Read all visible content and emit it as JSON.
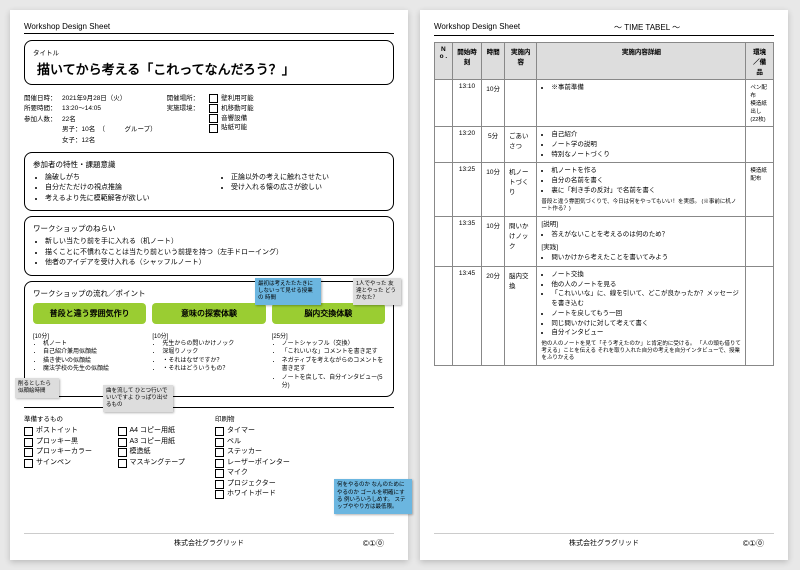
{
  "sheet_label": "Workshop Design Sheet",
  "timetable_label": "〜 TIME TABEL 〜",
  "title_label": "タイトル",
  "title": "描いてから考える「これってなんだろう？」",
  "meta": {
    "date_lbl": "開催日時：",
    "date": "2021年9月28日（火）",
    "time_lbl": "所要時間：",
    "time": "13:20〜14:05",
    "count_lbl": "参加人数：",
    "count": "22名",
    "count2": "男子：10名　（　　　グループ）",
    "count3": "女子：12名",
    "venue_lbl": "開催場所：",
    "env_lbl": "実施環境："
  },
  "env_opts": [
    "壁利用可能",
    "机移動可能",
    "音響設備",
    "貼紙可能"
  ],
  "sec1_h": "参加者の特性・課題意識",
  "sec1_a": [
    "論破しがち",
    "自分だただけの視点推論",
    "考えるより先に模範解答が欲しい"
  ],
  "sec1_b": [
    "正論以外の考えに触れさせたい",
    "受け入れる懐の広さが欲しい"
  ],
  "sec2_h": "ワークショップのねらい",
  "sec2": [
    "新しい当たり前を手に入れる（机ノート）",
    "描くことに不慣れなことは当たり前という前提を持つ（左手ドローイング）",
    "他者のアイデアを受け入れる（シャッフルノート）"
  ],
  "sec3_h": "ワークショップの流れ／ポイント",
  "flow": [
    {
      "t": "普段と違う雰囲気作り",
      "time": "[10分]",
      "d": [
        "机ノート",
        "自己紹介兼用似顔絵",
        "描き使いの似顔絵",
        "魔法学校の先生の似顔絵"
      ]
    },
    {
      "t": "意味の探索体験",
      "time": "[10分]",
      "d": [
        "先生からの問いかけノック",
        "深堀りノック",
        "・それはなぜですか？",
        "・それはどういうもの？"
      ]
    },
    {
      "t": "脳内交換体験",
      "time": "[25分]",
      "d": [
        "ノートシャッフル（交換）",
        "「これいいな」コメントを書き足す",
        "ネガティブを考えながらのコメントを書き足す",
        "ノートを戻して、自分インタビュー(5分)"
      ]
    }
  ],
  "prep_h": "準備するもの",
  "prep_a": [
    "ポストイット",
    "プロッキー黒",
    "プロッキーカラー",
    "サインペン",
    "A4 コピー用紙",
    "A3 コピー用紙",
    "模造紙",
    "マスキングテープ"
  ],
  "print_h": "印刷物",
  "prep_b": [
    "タイマー",
    "ベル",
    "ステッカー",
    "レーザーポインター",
    "マイク",
    "プロジェクター",
    "ホワイトボード"
  ],
  "notes": {
    "n1": "最初は考えたたたきに\nしないって見せる授業の\n時間",
    "n2": "1人でやった\n友達とやった\nどうかなた？",
    "n3": "削るとしたら\n似顔絵時間",
    "n4": "曲を流して\nひとつ行いでいいですよ\nひっぱり出せるもの",
    "n5": "何をやるのか\nなんのためにやるのか\nゴールを明確にする\n\n例いろいろしめす。\n\nステップややり方は最低限。"
  },
  "company": "株式会社グラグリッド",
  "cc": "©①⓪",
  "tt_head": [
    "N o .",
    "開始時刻",
    "時間",
    "実施内容",
    "実施内容詳細",
    "環境／備品"
  ],
  "tt": [
    {
      "s": "13:10",
      "d": "10分",
      "c": "",
      "det": [
        "※事前準備"
      ],
      "env": "ペン配布\n模造紙出し\n(22枚)"
    },
    {
      "s": "13:20",
      "d": "5分",
      "c": "ごあいさつ",
      "det": [
        "自己紹介",
        "ノート学の説明",
        "特別なノートづくり"
      ],
      "env": ""
    },
    {
      "s": "13:25",
      "d": "10分",
      "c": "机ノートづくり",
      "det": [
        "机ノートを作る",
        "自分の名前を書く",
        "裏に「利き手の反対」で名前を書く"
      ],
      "sm": "普段と違う雰囲気づくりで、今日は何をやってもいい！を実感。\n(※事前に机ノート作る？)",
      "env": "模造紙配布"
    },
    {
      "s": "13:35",
      "d": "10分",
      "c": "問いかけノック",
      "det_pre": "[説明]",
      "det": [
        "答えがないことを考えるのは何のため？"
      ],
      "det_pre2": "[実践]",
      "det2": [
        "問いかけから考えたことを書いてみよう"
      ],
      "env": ""
    },
    {
      "s": "13:45",
      "d": "20分",
      "c": "脳内交換",
      "det": [
        "ノート交換",
        "他の人のノートを見る",
        "「これいいな」に、線を引いて、どこが良かったか？メッセージを書き込む",
        "ノートを戻してもう一回",
        "同じ問いかけに対して考えて書く",
        "自分インタビュー"
      ],
      "sm": "他の人のノートを見て「そう考えたのか」と肯定的に受ける。\n「人の頭も借りて考える」ことを伝える\nそれを取り入れた自分の考えを自分インタビューで、授業をふりかえる",
      "env": ""
    }
  ]
}
